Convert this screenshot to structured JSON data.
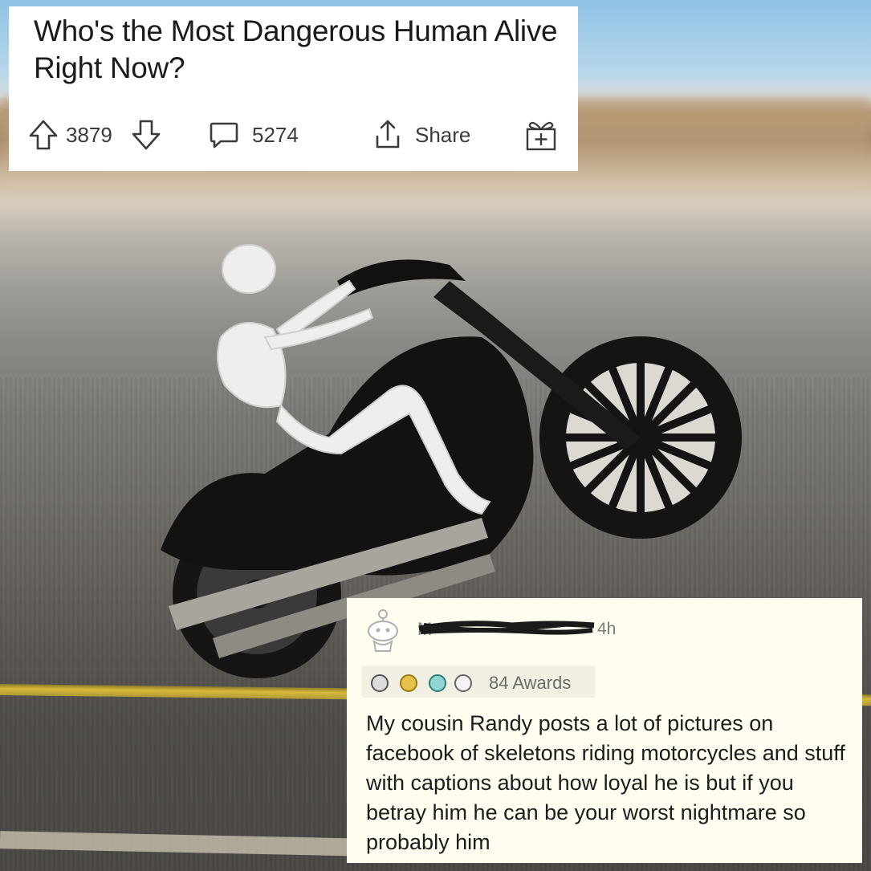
{
  "post": {
    "title": "Who's the Most Dangerous Human Alive Right Now?",
    "score": "3879",
    "comments": "5274",
    "share_label": "Share",
    "icons": [
      "upvote-arrow-icon",
      "downvote-arrow-icon",
      "comment-icon",
      "share-icon",
      "award-gift-icon"
    ]
  },
  "comment": {
    "time": "4h",
    "author_initial": "M",
    "awards_label": "84 Awards",
    "text": "My cousin Randy posts a lot of pictures on facebook of skeletons riding motorcycles and stuff with captions about how loyal he is but if you betray him he can be your worst nightmare so probably him",
    "icons": [
      "snoo-avatar-icon",
      "silver-award-icon",
      "gold-award-icon",
      "platinum-award-icon",
      "helpful-award-icon"
    ]
  },
  "colors": {
    "card_bg": "#ffffff",
    "comment_bg": "#fefdf0",
    "text": "#1a1a1b",
    "meta": "#7c7c7c"
  }
}
